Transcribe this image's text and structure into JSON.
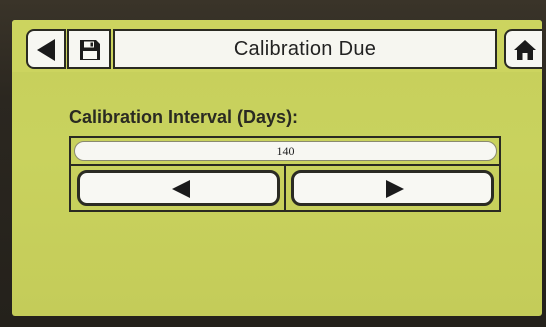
{
  "header": {
    "title": "Calibration Due",
    "back_icon": "back-arrow-icon",
    "save_icon": "floppy-disk-icon",
    "home_icon": "home-icon"
  },
  "interval": {
    "label": "Calibration Interval (Days):",
    "value": "140",
    "decrease_icon": "arrow-left-icon",
    "increase_icon": "arrow-right-icon"
  },
  "colors": {
    "screen_background": "#c8d15a",
    "button_face": "#f7f7f2",
    "outline": "#2a2a22"
  }
}
